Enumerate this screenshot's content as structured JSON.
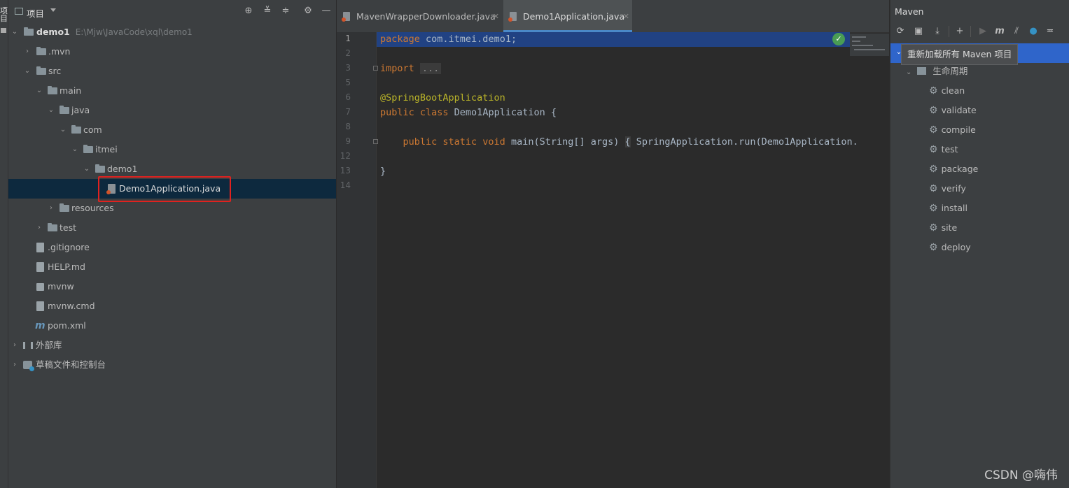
{
  "left_strip": {
    "tab_label": "项目"
  },
  "project_panel": {
    "title": "项目",
    "tree": [
      {
        "label": "demo1",
        "hint": "E:\\Mjw\\JavaCode\\xql\\demo1"
      },
      {
        "label": ".mvn"
      },
      {
        "label": "src"
      },
      {
        "label": "main"
      },
      {
        "label": "java"
      },
      {
        "label": "com"
      },
      {
        "label": "itmei"
      },
      {
        "label": "demo1"
      },
      {
        "label": "Demo1Application.java"
      },
      {
        "label": "resources"
      },
      {
        "label": "test"
      },
      {
        "label": ".gitignore"
      },
      {
        "label": "HELP.md"
      },
      {
        "label": "mvnw"
      },
      {
        "label": "mvnw.cmd"
      },
      {
        "label": "pom.xml"
      },
      {
        "label": "外部库"
      },
      {
        "label": "草稿文件和控制台"
      }
    ]
  },
  "editor": {
    "tabs": [
      {
        "label": "MavenWrapperDownloader.java"
      },
      {
        "label": "Demo1Application.java"
      }
    ],
    "line_numbers": [
      "1",
      "2",
      "3",
      "5",
      "6",
      "7",
      "8",
      "9",
      "12",
      "13",
      "14"
    ],
    "code": {
      "l1_kw": "package",
      "l1_rest": " com.itmei.demo1;",
      "l3_kw": "import",
      "l3_fold": "...",
      "l6_ann": "@SpringBootApplication",
      "l7_kw": "public class",
      "l7_rest": " Demo1Application {",
      "l9_kw": "public static void",
      "l9_mid": " main(String[] args) ",
      "l9_brace": "{",
      "l9_rest": " SpringApplication.run(Demo1Application.",
      "l13": "}"
    }
  },
  "maven": {
    "title": "Maven",
    "tooltip": "重新加载所有 Maven 项目",
    "lifecycle_label": "生命周期",
    "goals": [
      "clean",
      "validate",
      "compile",
      "test",
      "package",
      "verify",
      "install",
      "site",
      "deploy"
    ]
  },
  "watermark": "CSDN @嗨伟",
  "colors": {
    "selection": "#0d293e",
    "highlight_box": "#e0221f",
    "maven_selected": "#2f65ca",
    "caret_line": "#214283"
  }
}
